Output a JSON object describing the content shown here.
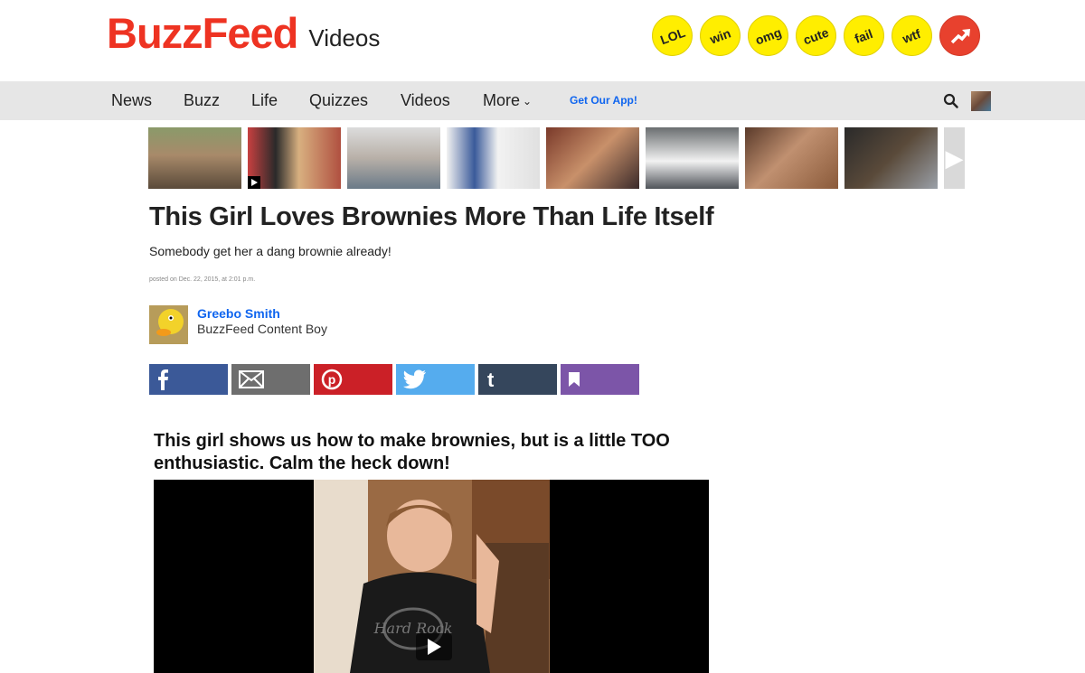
{
  "header": {
    "logo": "BuzzFeed",
    "section": "Videos",
    "badges": [
      "LOL",
      "win",
      "omg",
      "cute",
      "fail",
      "wtf"
    ],
    "badge_colors": {
      "yellow": "#ffee00",
      "trending": "#e8412e"
    }
  },
  "nav": {
    "items": [
      "News",
      "Buzz",
      "Life",
      "Quizzes",
      "Videos"
    ],
    "more": "More",
    "app": "Get Our App!"
  },
  "article": {
    "title": "This Girl Loves Brownies More Than Life Itself",
    "subtitle": "Somebody get her a dang brownie already!",
    "posted": "posted on Dec. 22, 2015, at 2:01 p.m.",
    "author_name": "Greebo Smith",
    "author_title": "BuzzFeed Content Boy"
  },
  "share": {
    "buttons": [
      {
        "name": "facebook",
        "color": "#3b5998"
      },
      {
        "name": "email",
        "color": "#6e6e6e"
      },
      {
        "name": "pinterest",
        "color": "#cb2027"
      },
      {
        "name": "twitter",
        "color": "#55acee"
      },
      {
        "name": "tumblr",
        "color": "#35465c"
      },
      {
        "name": "bookmark",
        "color": "#7c55a8"
      }
    ]
  },
  "video": {
    "heading": "This girl shows us how to make brownies, but is a little TOO enthusiastic. Calm the heck down!",
    "overlay": "Hard Rock"
  }
}
